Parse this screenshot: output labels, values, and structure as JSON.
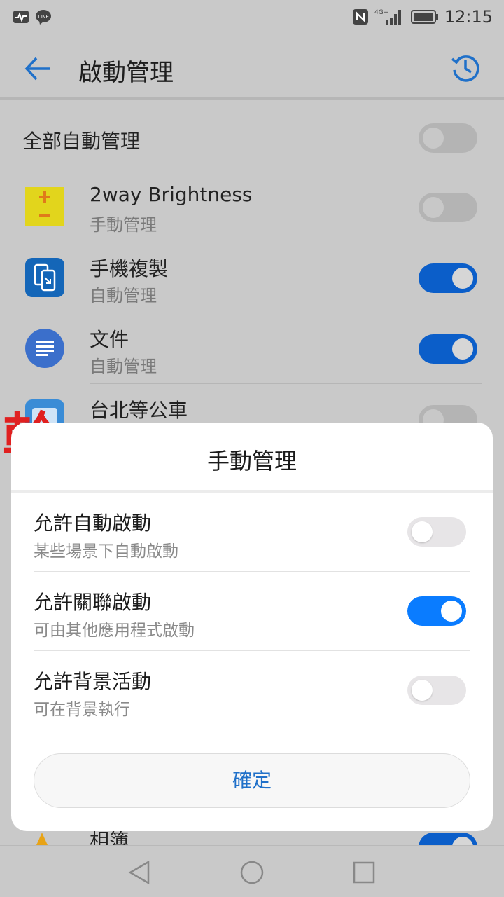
{
  "status_bar": {
    "time": "12:15",
    "network": "4G+",
    "left_icons": [
      "activity-icon",
      "line-app-icon"
    ],
    "right_icons": [
      "nfc-icon",
      "signal-icon",
      "battery-icon"
    ]
  },
  "app_bar": {
    "title": "啟動管理",
    "back_icon": "back-arrow-icon",
    "history_icon": "history-icon",
    "accent": "#1f70c9"
  },
  "list": {
    "all_label": "全部自動管理",
    "all_enabled": false,
    "apps": [
      {
        "name": "2way Brightness",
        "mode": "手動管理",
        "enabled": false,
        "icon": "brightness-app-icon"
      },
      {
        "name": "手機複製",
        "mode": "自動管理",
        "enabled": true,
        "icon": "phone-clone-app-icon"
      },
      {
        "name": "文件",
        "mode": "自動管理",
        "enabled": true,
        "icon": "docs-app-icon"
      },
      {
        "name": "台北等公車",
        "mode": "",
        "enabled": false,
        "icon": "bus-app-icon"
      },
      {
        "name": "相簿",
        "mode": "",
        "enabled": true,
        "icon": "gallery-app-icon"
      }
    ]
  },
  "dialog": {
    "title": "手動管理",
    "options": [
      {
        "title": "允許自動啟動",
        "subtitle": "某些場景下自動啟動",
        "enabled": false
      },
      {
        "title": "允許關聯啟動",
        "subtitle": "可由其他應用程式啟動",
        "enabled": true
      },
      {
        "title": "允許背景活動",
        "subtitle": "可在背景執行",
        "enabled": false
      }
    ],
    "confirm_label": "確定"
  },
  "watermark": {
    "text": "幹"
  },
  "nav_bar": {
    "buttons": [
      "back-triangle-icon",
      "home-circle-icon",
      "recents-square-icon"
    ]
  }
}
